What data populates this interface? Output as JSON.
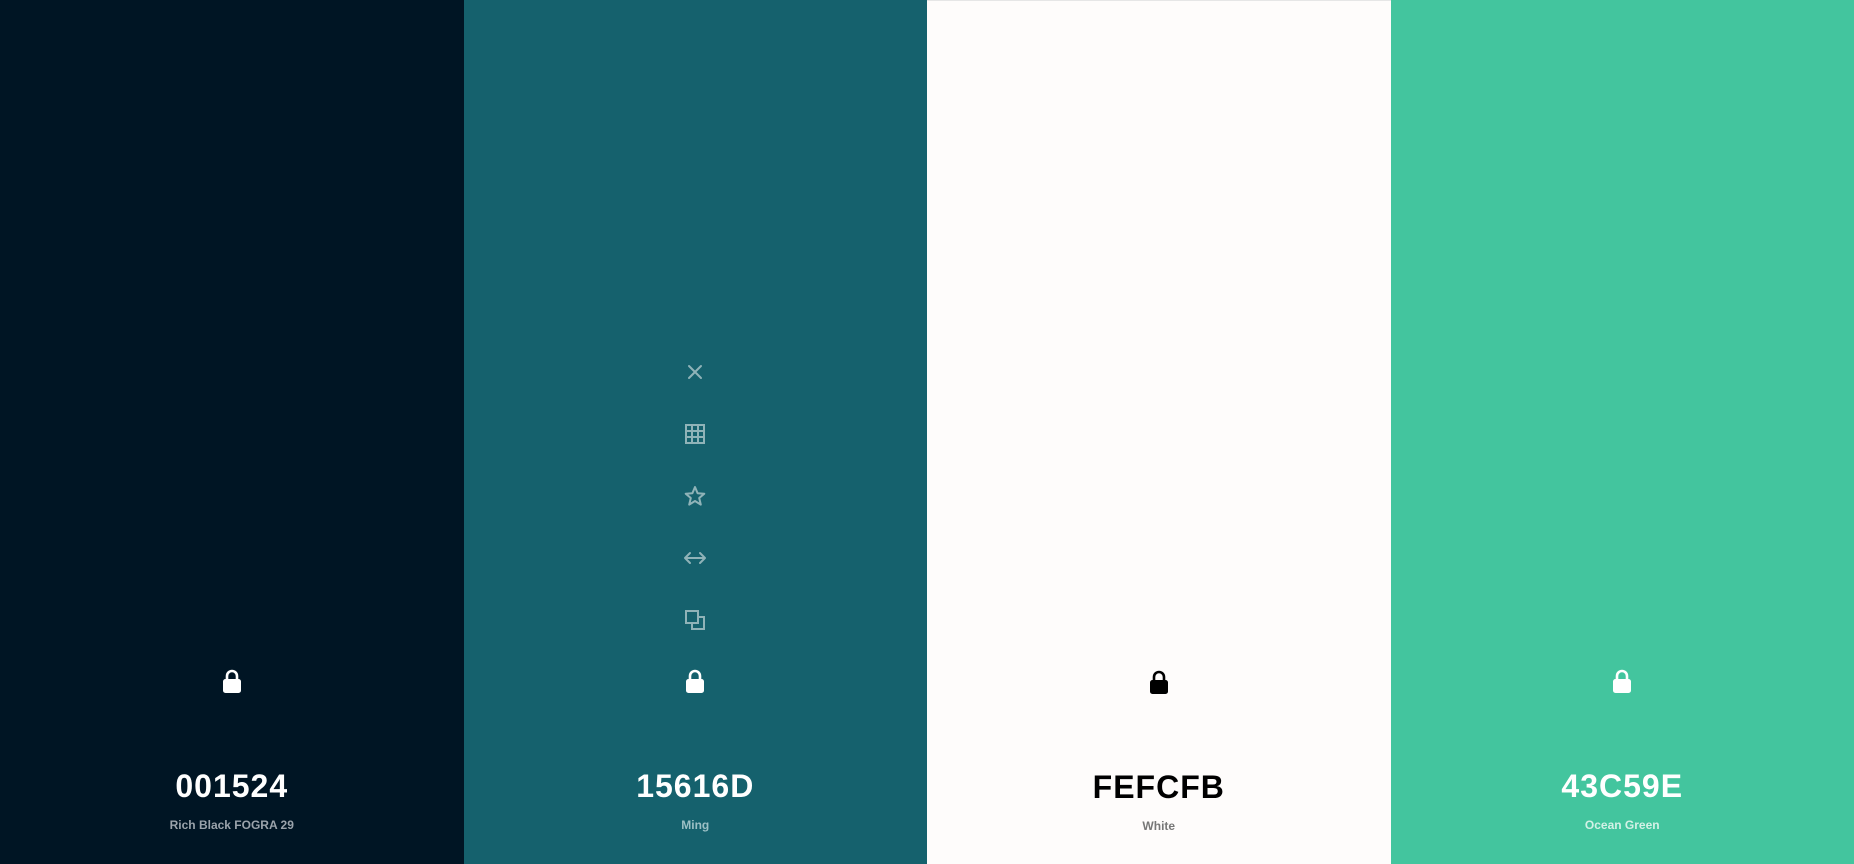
{
  "palette": [
    {
      "hex": "001524",
      "name": "Rich Black FOGRA 29",
      "background": "#001524",
      "text_color": "#ffffff",
      "name_color": "#9aa3ab",
      "lock_color": "#ffffff",
      "lock_icon": "lock-icon"
    },
    {
      "hex": "15616D",
      "name": "Ming",
      "background": "#15616D",
      "text_color": "#ffffff",
      "name_color": "#9cc0c5",
      "lock_color": "#ffffff",
      "lock_icon": "lock-icon",
      "tool_color": "#8fb3b8",
      "tools": [
        "close-icon",
        "grid-icon",
        "star-icon",
        "drag-arrows-icon",
        "copy-icon"
      ]
    },
    {
      "hex": "FEFCFB",
      "name": "White",
      "background": "#FEFCFB",
      "text_color": "#000000",
      "name_color": "#777777",
      "lock_color": "#000000",
      "lock_icon": "lock-icon"
    },
    {
      "hex": "43C59E",
      "name": "Ocean Green",
      "background": "#43C59E",
      "text_color": "#ffffff",
      "name_color": "#d3f1e6",
      "lock_color": "#ffffff",
      "lock_icon": "lock-icon"
    }
  ]
}
